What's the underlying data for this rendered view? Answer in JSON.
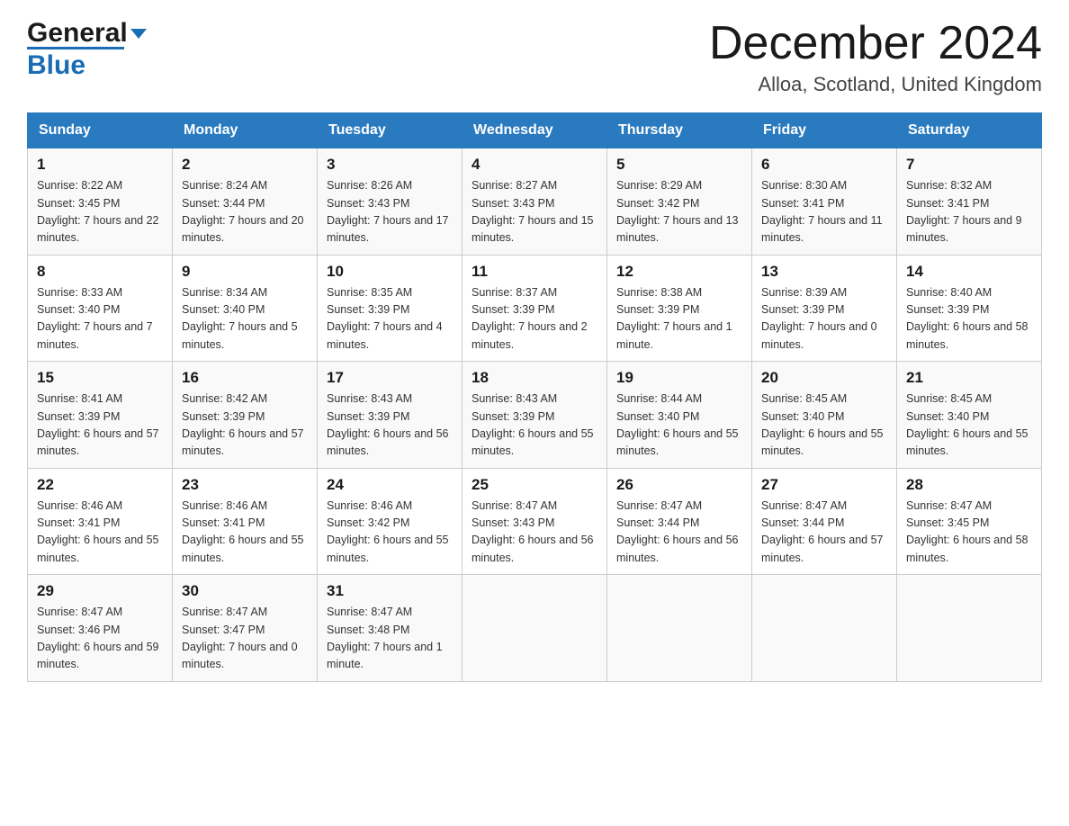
{
  "header": {
    "logo_general": "General",
    "logo_blue": "Blue",
    "month_title": "December 2024",
    "location": "Alloa, Scotland, United Kingdom"
  },
  "columns": [
    "Sunday",
    "Monday",
    "Tuesday",
    "Wednesday",
    "Thursday",
    "Friday",
    "Saturday"
  ],
  "weeks": [
    [
      {
        "day": "1",
        "sunrise": "8:22 AM",
        "sunset": "3:45 PM",
        "daylight": "7 hours and 22 minutes."
      },
      {
        "day": "2",
        "sunrise": "8:24 AM",
        "sunset": "3:44 PM",
        "daylight": "7 hours and 20 minutes."
      },
      {
        "day": "3",
        "sunrise": "8:26 AM",
        "sunset": "3:43 PM",
        "daylight": "7 hours and 17 minutes."
      },
      {
        "day": "4",
        "sunrise": "8:27 AM",
        "sunset": "3:43 PM",
        "daylight": "7 hours and 15 minutes."
      },
      {
        "day": "5",
        "sunrise": "8:29 AM",
        "sunset": "3:42 PM",
        "daylight": "7 hours and 13 minutes."
      },
      {
        "day": "6",
        "sunrise": "8:30 AM",
        "sunset": "3:41 PM",
        "daylight": "7 hours and 11 minutes."
      },
      {
        "day": "7",
        "sunrise": "8:32 AM",
        "sunset": "3:41 PM",
        "daylight": "7 hours and 9 minutes."
      }
    ],
    [
      {
        "day": "8",
        "sunrise": "8:33 AM",
        "sunset": "3:40 PM",
        "daylight": "7 hours and 7 minutes."
      },
      {
        "day": "9",
        "sunrise": "8:34 AM",
        "sunset": "3:40 PM",
        "daylight": "7 hours and 5 minutes."
      },
      {
        "day": "10",
        "sunrise": "8:35 AM",
        "sunset": "3:39 PM",
        "daylight": "7 hours and 4 minutes."
      },
      {
        "day": "11",
        "sunrise": "8:37 AM",
        "sunset": "3:39 PM",
        "daylight": "7 hours and 2 minutes."
      },
      {
        "day": "12",
        "sunrise": "8:38 AM",
        "sunset": "3:39 PM",
        "daylight": "7 hours and 1 minute."
      },
      {
        "day": "13",
        "sunrise": "8:39 AM",
        "sunset": "3:39 PM",
        "daylight": "7 hours and 0 minutes."
      },
      {
        "day": "14",
        "sunrise": "8:40 AM",
        "sunset": "3:39 PM",
        "daylight": "6 hours and 58 minutes."
      }
    ],
    [
      {
        "day": "15",
        "sunrise": "8:41 AM",
        "sunset": "3:39 PM",
        "daylight": "6 hours and 57 minutes."
      },
      {
        "day": "16",
        "sunrise": "8:42 AM",
        "sunset": "3:39 PM",
        "daylight": "6 hours and 57 minutes."
      },
      {
        "day": "17",
        "sunrise": "8:43 AM",
        "sunset": "3:39 PM",
        "daylight": "6 hours and 56 minutes."
      },
      {
        "day": "18",
        "sunrise": "8:43 AM",
        "sunset": "3:39 PM",
        "daylight": "6 hours and 55 minutes."
      },
      {
        "day": "19",
        "sunrise": "8:44 AM",
        "sunset": "3:40 PM",
        "daylight": "6 hours and 55 minutes."
      },
      {
        "day": "20",
        "sunrise": "8:45 AM",
        "sunset": "3:40 PM",
        "daylight": "6 hours and 55 minutes."
      },
      {
        "day": "21",
        "sunrise": "8:45 AM",
        "sunset": "3:40 PM",
        "daylight": "6 hours and 55 minutes."
      }
    ],
    [
      {
        "day": "22",
        "sunrise": "8:46 AM",
        "sunset": "3:41 PM",
        "daylight": "6 hours and 55 minutes."
      },
      {
        "day": "23",
        "sunrise": "8:46 AM",
        "sunset": "3:41 PM",
        "daylight": "6 hours and 55 minutes."
      },
      {
        "day": "24",
        "sunrise": "8:46 AM",
        "sunset": "3:42 PM",
        "daylight": "6 hours and 55 minutes."
      },
      {
        "day": "25",
        "sunrise": "8:47 AM",
        "sunset": "3:43 PM",
        "daylight": "6 hours and 56 minutes."
      },
      {
        "day": "26",
        "sunrise": "8:47 AM",
        "sunset": "3:44 PM",
        "daylight": "6 hours and 56 minutes."
      },
      {
        "day": "27",
        "sunrise": "8:47 AM",
        "sunset": "3:44 PM",
        "daylight": "6 hours and 57 minutes."
      },
      {
        "day": "28",
        "sunrise": "8:47 AM",
        "sunset": "3:45 PM",
        "daylight": "6 hours and 58 minutes."
      }
    ],
    [
      {
        "day": "29",
        "sunrise": "8:47 AM",
        "sunset": "3:46 PM",
        "daylight": "6 hours and 59 minutes."
      },
      {
        "day": "30",
        "sunrise": "8:47 AM",
        "sunset": "3:47 PM",
        "daylight": "7 hours and 0 minutes."
      },
      {
        "day": "31",
        "sunrise": "8:47 AM",
        "sunset": "3:48 PM",
        "daylight": "7 hours and 1 minute."
      },
      null,
      null,
      null,
      null
    ]
  ]
}
